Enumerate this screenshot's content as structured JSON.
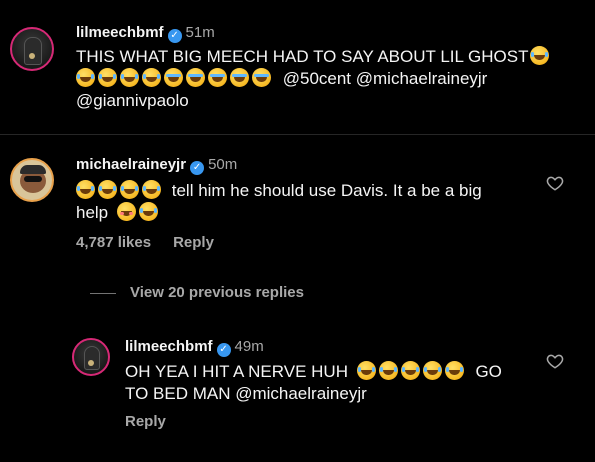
{
  "comments": [
    {
      "username": "lilmeechbmf",
      "time": "51m",
      "text_line1": "THIS WHAT BIG MEECH HAD TO SAY ABOUT LIL GHOST",
      "mentions_line2": "@50cent @michaelraineyjr",
      "mentions_line3": "@giannivpaolo"
    },
    {
      "username": "michaelraineyjr",
      "time": "50m",
      "text_line1": "tell him he should use Davis. It a be a big",
      "text_line2": "help",
      "likes": "4,787 likes",
      "reply_label": "Reply"
    }
  ],
  "view_replies": "View 20 previous replies",
  "reply": {
    "username": "lilmeechbmf",
    "time": "49m",
    "text_line1a": "OH YEA I HIT A NERVE HUH",
    "text_line1b": "GO",
    "text_line2": "TO BED MAN @michaelraineyjr",
    "reply_label": "Reply"
  },
  "icons": {
    "verified": "verified-badge-icon",
    "heart": "heart-outline-icon",
    "emoji_laugh": "face-with-tears-of-joy",
    "emoji_cry": "loudly-crying-face",
    "emoji_blush": "blushing-face"
  },
  "colors": {
    "background": "#000000",
    "text": "#f5f5f5",
    "muted": "#a8a8a8",
    "verified": "#3897f0"
  }
}
